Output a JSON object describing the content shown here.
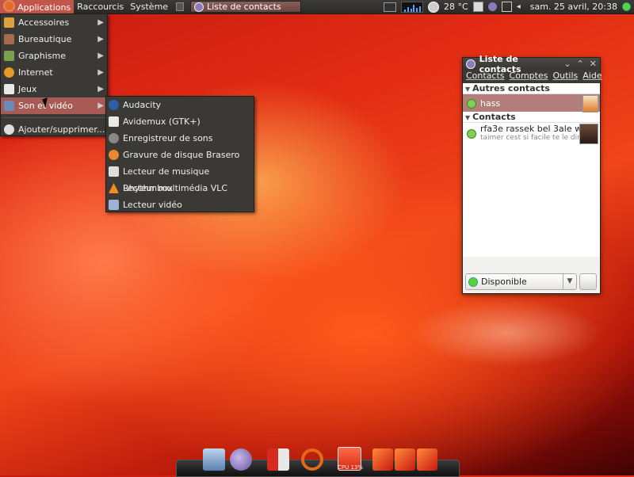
{
  "top_panel": {
    "menus": [
      "Applications",
      "Raccourcis",
      "Système"
    ],
    "task_title": "Liste de contacts",
    "temperature": "28 °C",
    "datetime": "sam. 25 avril, 20:38"
  },
  "apps_menu": {
    "items": [
      {
        "label": "Accessoires",
        "icon": "accessories-icon",
        "color": "#d9a43b"
      },
      {
        "label": "Bureautique",
        "icon": "office-icon",
        "color": "#a36b4f"
      },
      {
        "label": "Graphisme",
        "icon": "graphics-icon",
        "color": "#7aa150"
      },
      {
        "label": "Internet",
        "icon": "internet-icon",
        "color": "#e39b25"
      },
      {
        "label": "Jeux",
        "icon": "games-icon",
        "color": "#e8e8e8"
      },
      {
        "label": "Son et vidéo",
        "icon": "multimedia-icon",
        "color": "#6c8ab8"
      }
    ],
    "add_remove": "Ajouter/supprimer..."
  },
  "sub_menu": {
    "items": [
      {
        "label": "Audacity",
        "icon": "audacity-icon",
        "color": "#2f5ea8"
      },
      {
        "label": "Avidemux (GTK+)",
        "icon": "avidemux-icon",
        "color": "#e9e9e9"
      },
      {
        "label": "Enregistreur de sons",
        "icon": "microphone-icon",
        "color": "#888"
      },
      {
        "label": "Gravure de disque Brasero",
        "icon": "brasero-icon",
        "color": "#e88a2b"
      },
      {
        "label": "Lecteur de musique Rhythmbox",
        "icon": "rhythmbox-icon",
        "color": "#ddd"
      },
      {
        "label": "Lecteur multimédia VLC",
        "icon": "vlc-icon",
        "color": "#f28c1e"
      },
      {
        "label": "Lecteur vidéo",
        "icon": "video-player-icon",
        "color": "#9cb4d4"
      }
    ]
  },
  "contact_window": {
    "title": "Liste de contacts",
    "menubar": [
      "Contacts",
      "Comptes",
      "Outils",
      "Aide"
    ],
    "groups": [
      {
        "name": "Autres contacts",
        "contacts": [
          {
            "name": "hass",
            "message": ""
          }
        ]
      },
      {
        "name": "Contacts",
        "contacts": [
          {
            "name": "rfa3e rassek bel 3ale wi ...",
            "message": "taimer cest si facile te le dire..."
          }
        ]
      }
    ],
    "status": "Disponible"
  },
  "dock": {
    "cpu_label": "CPU 13%"
  },
  "colors": {
    "panel": "#3c3b37",
    "highlight": "#a85b55",
    "available": "#7fd052"
  }
}
